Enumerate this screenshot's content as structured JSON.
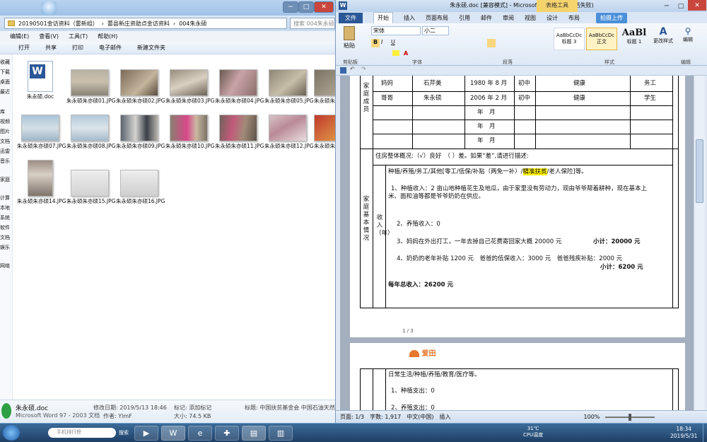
{
  "explorer": {
    "breadcrumb": [
      "20190501金访资料（雷新组）",
      "蕾县新庄资助点金访资料",
      "004朱永硕"
    ],
    "search_placeholder": "搜索 004朱永硕",
    "menu": [
      "编辑(E)",
      "查看(V)",
      "工具(T)",
      "帮助(H)"
    ],
    "toolbar": [
      "打开",
      "共享",
      "打印",
      "电子邮件",
      "新建文件夹"
    ],
    "nav_items": [
      "收藏",
      "下载",
      "桌面",
      "最近",
      "库",
      "视频",
      "图片",
      "文档",
      "迅雷",
      "音乐",
      "家庭",
      "计算",
      "本地",
      "系统",
      "软件",
      "文档",
      "娱乐",
      "网络"
    ],
    "files": [
      {
        "name": "朱永硕.doc"
      },
      {
        "name": "朱永硕朱亦硕01.JPG"
      },
      {
        "name": "朱永硕朱亦硕02.JPG"
      },
      {
        "name": "朱永硕朱亦硕03.JPG"
      },
      {
        "name": "朱永硕朱亦硕04.JPG"
      },
      {
        "name": "朱永硕朱亦硕05.JPG"
      },
      {
        "name": "朱永硕朱亦硕06"
      },
      {
        "name": "朱永硕朱亦硕07.JPG"
      },
      {
        "name": "朱永硕朱亦硕08.JPG"
      },
      {
        "name": "朱永硕朱亦硕09.JPG"
      },
      {
        "name": "朱永硕朱亦硕10.JPG"
      },
      {
        "name": "朱永硕朱亦硕11.JPG"
      },
      {
        "name": "朱永硕朱亦硕12.JPG"
      },
      {
        "name": "朱永硕朱亦硕13"
      },
      {
        "name": "朱永硕朱亦硕14.JPG"
      },
      {
        "name": "朱永硕朱亦硕15.JPG"
      },
      {
        "name": "朱永硕朱亦硕16.JPG"
      }
    ],
    "details": {
      "name": "朱永硕.doc",
      "type": "Microsoft Word 97 - 2003 文档",
      "modified": "修改日期: 2019/5/13 18:46",
      "author": "作者: YlmF",
      "tags": "标记: 添加标记",
      "size": "大小: 74.5 KB",
      "title": "标题: 中国扶贫基金会 中国石油天然气集"
    }
  },
  "word": {
    "title": "朱永硕.doc [兼容模式] - Microsoft Word(产品激活失败)",
    "table_tools": "表格工具",
    "tabs": [
      "文件",
      "开始",
      "插入",
      "页面布局",
      "引用",
      "邮件",
      "审阅",
      "视图",
      "设计",
      "布局"
    ],
    "cloud_button": "拍摄上传",
    "ribbon": {
      "font_name": "宋体",
      "font_size": "小二",
      "groups": [
        "剪贴板",
        "字体",
        "段落",
        "样式",
        "编辑"
      ],
      "styles": [
        {
          "sample": "AaBbCcDc",
          "label": "标题 3"
        },
        {
          "sample": "AaBbCcDc",
          "label": "正文"
        },
        {
          "sample": "AaBl",
          "label": "标题 1"
        }
      ],
      "paste": "粘贴",
      "change_styles": "更改样式",
      "edit": "编辑"
    },
    "table": {
      "family_label": "家庭成员",
      "rows": [
        [
          "妈妈",
          "石芹美",
          "1980 年 8 月",
          "初中",
          "健康",
          "务工"
        ],
        [
          "哥哥",
          "朱永硕",
          "2006 年 2 月",
          "初中",
          "健康",
          "学生"
        ],
        [
          "",
          "",
          "年　月",
          "",
          "",
          ""
        ],
        [
          "",
          "",
          "年　月",
          "",
          "",
          ""
        ],
        [
          "",
          "",
          "年　月",
          "",
          "",
          ""
        ]
      ],
      "housing": "住房整体概况:（√）良好　（ ）差。如果“差”,请进行描述:",
      "basic_label": "家庭基本情况",
      "income_label": "收入（年）",
      "income_header_a": "种植/养殖/务工/其他[零工/低保/补贴（两免一补）/",
      "income_header_hl": "精准扶贫",
      "income_header_b": "/老人保险]等。",
      "item1": "1、种植收入：2 亩山地种植花生及地瓜，由于家里没有劳动力，现由爷爷帮着耕种，现在基本上",
      "item1b": "米、面和油等都是爷爷奶奶在供应。",
      "item2": "2、养殖收入：0",
      "item3": "3、妈妈在外出打工，一年去掉自己花费寄回家大概 20000 元",
      "item3_sub": "小计：20000 元",
      "item4": "4、奶奶的老年补贴 1200 元　爸爸的低保收入：3000 元　爸爸残疾补贴：2000 元",
      "item4_sub": "小计：6200 元",
      "total": "每年总收入：26200 元",
      "page_num": "1 / 3",
      "page2_header": "日常生活/种植/养殖/教育/医疗等。",
      "page2_item1": "1、种植支出：0",
      "page2_item2": "2、养殖支出：0",
      "logo_text": "爱田"
    },
    "status": {
      "page": "页面: 1/3",
      "words": "字数: 1,917",
      "lang": "中文(中国)",
      "mode": "插入",
      "zoom": "100%"
    }
  },
  "taskbar": {
    "search_placeholder": "手机排行榜",
    "search_button": "搜索",
    "temp": "31℃",
    "cpu": "CPU温度",
    "time": "18:34",
    "date": "2019/5/31"
  }
}
